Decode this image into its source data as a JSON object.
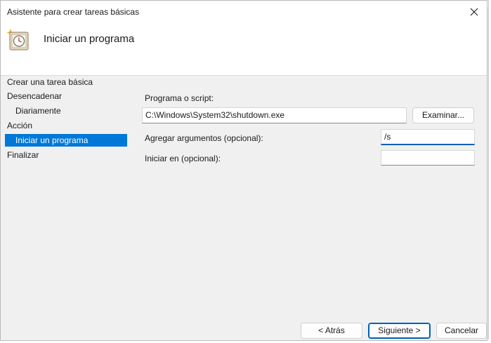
{
  "window": {
    "title": "Asistente para crear tareas básicas",
    "close_glyph": "✕"
  },
  "header": {
    "title": "Iniciar un programa",
    "icon": "task-clock-icon"
  },
  "nav": {
    "items": [
      {
        "label": "Crear una tarea básica"
      },
      {
        "label": "Desencadenar"
      },
      {
        "label": "Diariamente"
      },
      {
        "label": "Acción"
      },
      {
        "label": "Iniciar un programa"
      },
      {
        "label": "Finalizar"
      }
    ],
    "selected_index": 4
  },
  "form": {
    "program_label": "Programa o script:",
    "program_value": "C:\\Windows\\System32\\shutdown.exe",
    "browse_button": "Examinar...",
    "args_label": "Agregar argumentos (opcional):",
    "args_value": "/s",
    "start_in_label": "Iniciar en (opcional):",
    "start_in_value": ""
  },
  "buttons": {
    "back": "< Atrás",
    "next": "Siguiente >",
    "cancel": "Cancelar"
  },
  "colors": {
    "accent": "#0078d7",
    "dialog_bg": "#f0f0f0",
    "header_bg": "#ffffff"
  }
}
